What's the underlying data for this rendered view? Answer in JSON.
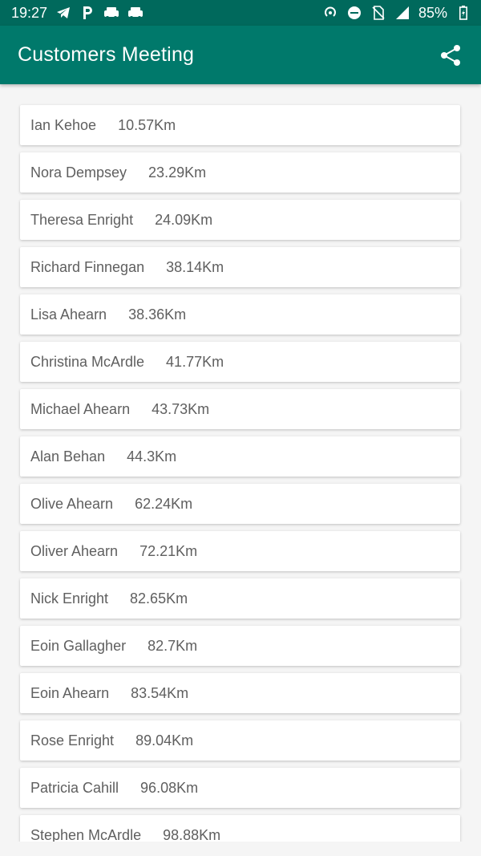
{
  "status_bar": {
    "time": "19:27",
    "battery": "85%",
    "icons_left": [
      "telegram-icon",
      "parking-icon",
      "car-icon",
      "car-icon"
    ],
    "icons_right": [
      "hotspot-icon",
      "do-not-disturb-icon",
      "sim-off-icon",
      "signal-4g-icon",
      "battery-icon"
    ]
  },
  "app_bar": {
    "title": "Customers Meeting",
    "share_icon": "share-icon",
    "color": "#00796b",
    "status_color": "#00695c"
  },
  "customers": [
    {
      "name": "Ian Kehoe",
      "distance": "10.57Km"
    },
    {
      "name": "Nora Dempsey",
      "distance": "23.29Km"
    },
    {
      "name": "Theresa Enright",
      "distance": "24.09Km"
    },
    {
      "name": "Richard Finnegan",
      "distance": "38.14Km"
    },
    {
      "name": "Lisa Ahearn",
      "distance": "38.36Km"
    },
    {
      "name": "Christina McArdle",
      "distance": "41.77Km"
    },
    {
      "name": "Michael Ahearn",
      "distance": "43.73Km"
    },
    {
      "name": "Alan Behan",
      "distance": "44.3Km"
    },
    {
      "name": "Olive Ahearn",
      "distance": "62.24Km"
    },
    {
      "name": "Oliver Ahearn",
      "distance": "72.21Km"
    },
    {
      "name": "Nick Enright",
      "distance": "82.65Km"
    },
    {
      "name": "Eoin Gallagher",
      "distance": "82.7Km"
    },
    {
      "name": "Eoin Ahearn",
      "distance": "83.54Km"
    },
    {
      "name": "Rose Enright",
      "distance": "89.04Km"
    },
    {
      "name": "Patricia Cahill",
      "distance": "96.08Km"
    },
    {
      "name": "Stephen McArdle",
      "distance": "98.88Km"
    }
  ]
}
